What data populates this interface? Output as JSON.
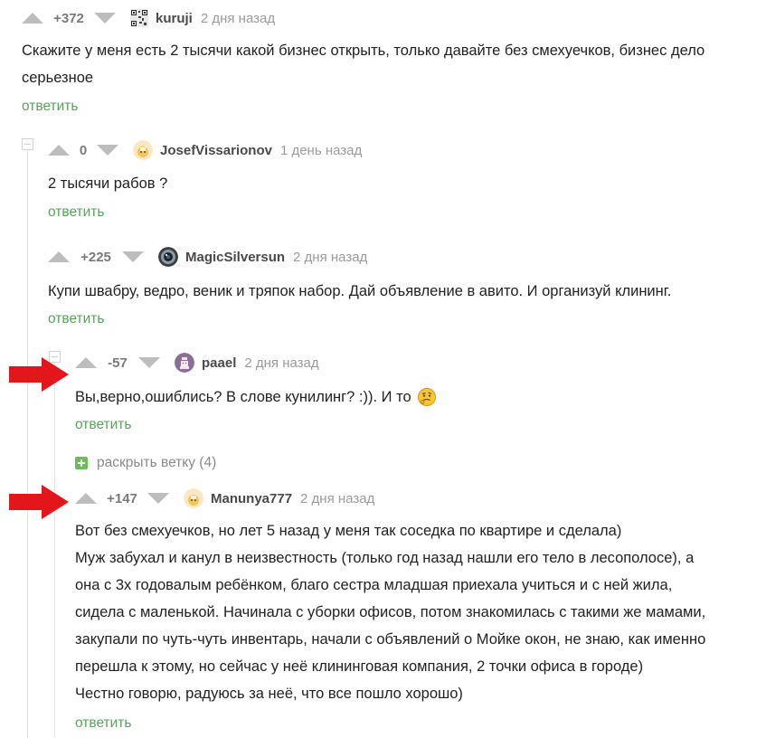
{
  "comments": [
    {
      "rating": "+372",
      "author": "kuruji",
      "time": "2 дня назад",
      "text_lines": [
        "Скажите у меня есть 2 тысячи какой бизнес открыть, только давайте без смехуечков, бизнес дело",
        "серьезное"
      ],
      "reply": "ответить"
    },
    {
      "rating": "0",
      "author": "JosefVissarionov",
      "time": "1 день назад",
      "text_lines": [
        "2 тысячи рабов ?"
      ],
      "reply": "ответить"
    },
    {
      "rating": "+225",
      "author": "MagicSilversun",
      "time": "2 дня назад",
      "text_lines": [
        "Купи швабру, ведро, веник и тряпок набор. Дай объявление в авито. И организуй клининг."
      ],
      "reply": "ответить"
    },
    {
      "rating": "-57",
      "author": "paael",
      "time": "2 дня назад",
      "text_lines": [
        "Вы,верно,ошиблись? В слове кунилинг? :)). И то"
      ],
      "reply": "ответить"
    },
    {
      "rating": "+147",
      "author": "Manunya777",
      "time": "2 дня назад",
      "text_lines": [
        "Вот без смехуечков, но лет 5 назад у меня так соседка по квартире и сделала)",
        "Муж забухал и канул в неизвестность (только год назад нашли его тело в лесополосе), а",
        "она с 3х годовалым ребёнком, благо сестра младшая приехала учиться и с ней жила,",
        "сидела с маленькой. Начинала с уборки офисов, потом знакомилась с такими же мамами,",
        "закупали по чуть-чуть инвентарь, начали с объявлений о Мойке окон, не знаю, как именно",
        "перешла к этому, но сейчас у неё клининговая компания, 2 точки офиса в городе)",
        "Честно говорю, радуюсь за неё, что все пошло хорошо)"
      ],
      "reply": "ответить"
    }
  ],
  "expand_branch": "раскрыть ветку (4)",
  "icons": {
    "upvote": "upvote-arrow-icon",
    "downvote": "downvote-arrow-icon",
    "emoji": "thinking-face-emoji-icon",
    "annotation": "red-arrow-annotation-icon"
  },
  "colors": {
    "reply_link": "#57a55a",
    "arrow_gray": "#bdbdbd",
    "annotation_red": "#e3171b"
  }
}
